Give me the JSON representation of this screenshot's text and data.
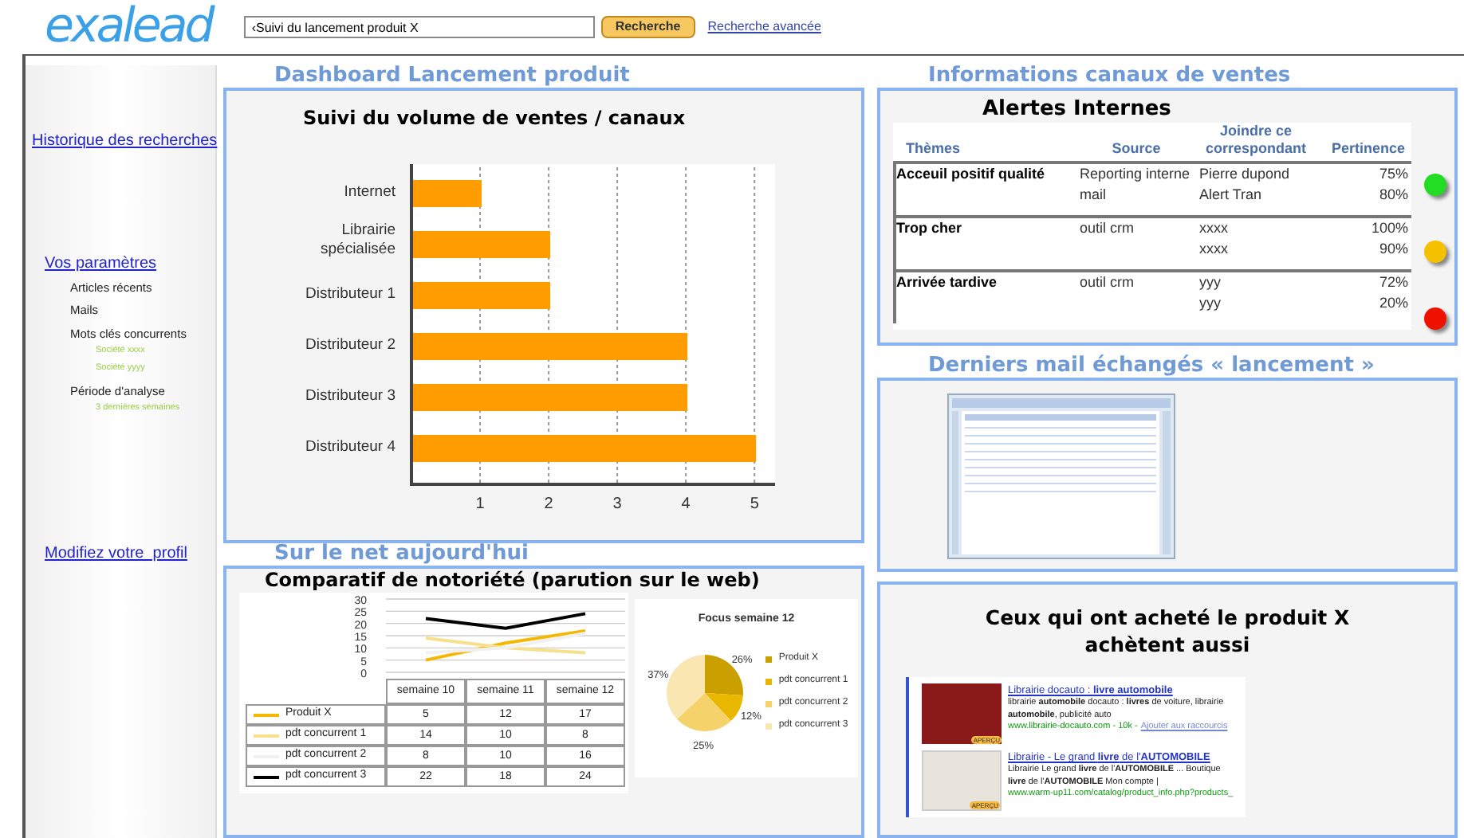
{
  "header": {
    "logo": "exalead",
    "search": {
      "value": "‹Suivi du lancement produit X"
    },
    "search_button": "Recherche",
    "advanced_link": "Recherche avancée"
  },
  "sidebar": {
    "history_link": "Historique des recherches",
    "params_link": "Vos paramètres",
    "params": [
      {
        "label": "Articles récents"
      },
      {
        "label": "Mails"
      },
      {
        "label": "Mots clés concurrents",
        "values": [
          "Société xxxx",
          "Société yyyy"
        ]
      },
      {
        "label": "Période d'analyse",
        "values": [
          "3 dernières semaines"
        ]
      }
    ],
    "profile_link": "Modifiez votre  profil"
  },
  "dashboard": {
    "title": "Dashboard Lancement produit",
    "chart_data": {
      "type": "bar",
      "orientation": "horizontal",
      "title": "Suivi du volume de ventes / canaux",
      "categories": [
        "Internet",
        "Librairie spécialisée",
        "Distributeur 1",
        "Distributeur 2",
        "Distributeur 3",
        "Distributeur 4"
      ],
      "values": [
        1,
        2,
        2,
        4,
        4,
        5
      ],
      "xlim": [
        0,
        5.3
      ],
      "xticks": [
        1,
        2,
        3,
        4,
        5
      ],
      "grid": true
    }
  },
  "web": {
    "title": "Sur le net aujourd'hui",
    "panel_title": "Comparatif de notoriété (parution sur le web)",
    "line_chart": {
      "chart_data": {
        "type": "line",
        "categories": [
          "semaine 10",
          "semaine 11",
          "semaine 12"
        ],
        "yticks": [
          0,
          5,
          10,
          15,
          20,
          25,
          30
        ],
        "ylim": [
          0,
          30
        ],
        "grid": true,
        "legend": "bottom",
        "series": [
          {
            "name": "Produit X",
            "color": "#f5b800",
            "values": [
              5,
              12,
              17
            ]
          },
          {
            "name": "pdt concurrent 1",
            "color": "#f7e08c",
            "values": [
              14,
              10,
              8
            ]
          },
          {
            "name": "pdt concurrent 2",
            "color": "#f1f1f1",
            "values": [
              8,
              10,
              16
            ]
          },
          {
            "name": "pdt concurrent 3",
            "color": "#000000",
            "values": [
              22,
              18,
              24
            ]
          }
        ]
      }
    },
    "data_table": {
      "rows": [
        {
          "cells": [
            "5",
            "12",
            "17"
          ]
        },
        {
          "cells": [
            "14",
            "10",
            "8"
          ]
        },
        {
          "cells": [
            "8",
            "10",
            "16"
          ]
        },
        {
          "cells": [
            "22",
            "18",
            "24"
          ]
        }
      ]
    },
    "pie_chart": {
      "chart_data": {
        "type": "pie",
        "title": "Focus semaine 12",
        "categories": [
          "Produit X",
          "pdt concurrent 1",
          "pdt concurrent 2",
          "pdt concurrent 3"
        ],
        "values": [
          26,
          12,
          25,
          37
        ],
        "value_labels": [
          "26%",
          "12%",
          "25%",
          "37%"
        ],
        "legend": "right"
      }
    }
  },
  "sales_info": {
    "title": "Informations canaux de ventes",
    "alerts": {
      "title": "Alertes Internes",
      "columns": [
        "Thèmes",
        "Source",
        "Joindre ce correspondant",
        "Pertinence"
      ],
      "groups": [
        {
          "theme": "Acceuil positif qualité",
          "color": "#22dd22",
          "rows": [
            {
              "source": "Reporting interne",
              "contact": "Pierre dupond",
              "pertinence": "75%"
            },
            {
              "source": "mail",
              "contact": "Alert Tran",
              "pertinence": "80%"
            }
          ]
        },
        {
          "theme": "Trop cher",
          "color": "#f5c000",
          "rows": [
            {
              "source": "outil crm",
              "contact": "xxxx",
              "pertinence": "100%"
            },
            {
              "contact": "xxxx",
              "pertinence": "90%"
            }
          ]
        },
        {
          "theme": "Arrivée tardive",
          "color": "#ee1100",
          "rows": [
            {
              "source": "outil crm",
              "contact": "yyy",
              "pertinence": "72%"
            },
            {
              "contact": "yyy",
              "pertinence": "20%"
            }
          ]
        }
      ]
    }
  },
  "mails": {
    "title": "Derniers mail échangés « lancement »"
  },
  "also_bought": {
    "title": "Ceux qui ont acheté le produit X achètent aussi",
    "results": [
      {
        "badge": "APERÇU",
        "title": "Librairie docauto : **livre automobile**",
        "snippet": "librairie **automobile** docauto : **livres** de voiture, librairie",
        "snippet2": "**automobile**, publicité auto",
        "url": "www.librairie-docauto.com - 10k -",
        "extra_link": "Ajouter aux raccourcis"
      },
      {
        "badge": "APERÇU",
        "title": "Librairie - Le grand **livre** de l'**AUTOMOBILE**",
        "snippet": "Librairie Le grand **livre** de l'**AUTOMOBILE** ... Boutique",
        "snippet2": "**livre** de l'**AUTOMOBILE** Mon compte |",
        "url": "www.warm-up11.com/catalog/product_info.php?products_"
      }
    ]
  }
}
